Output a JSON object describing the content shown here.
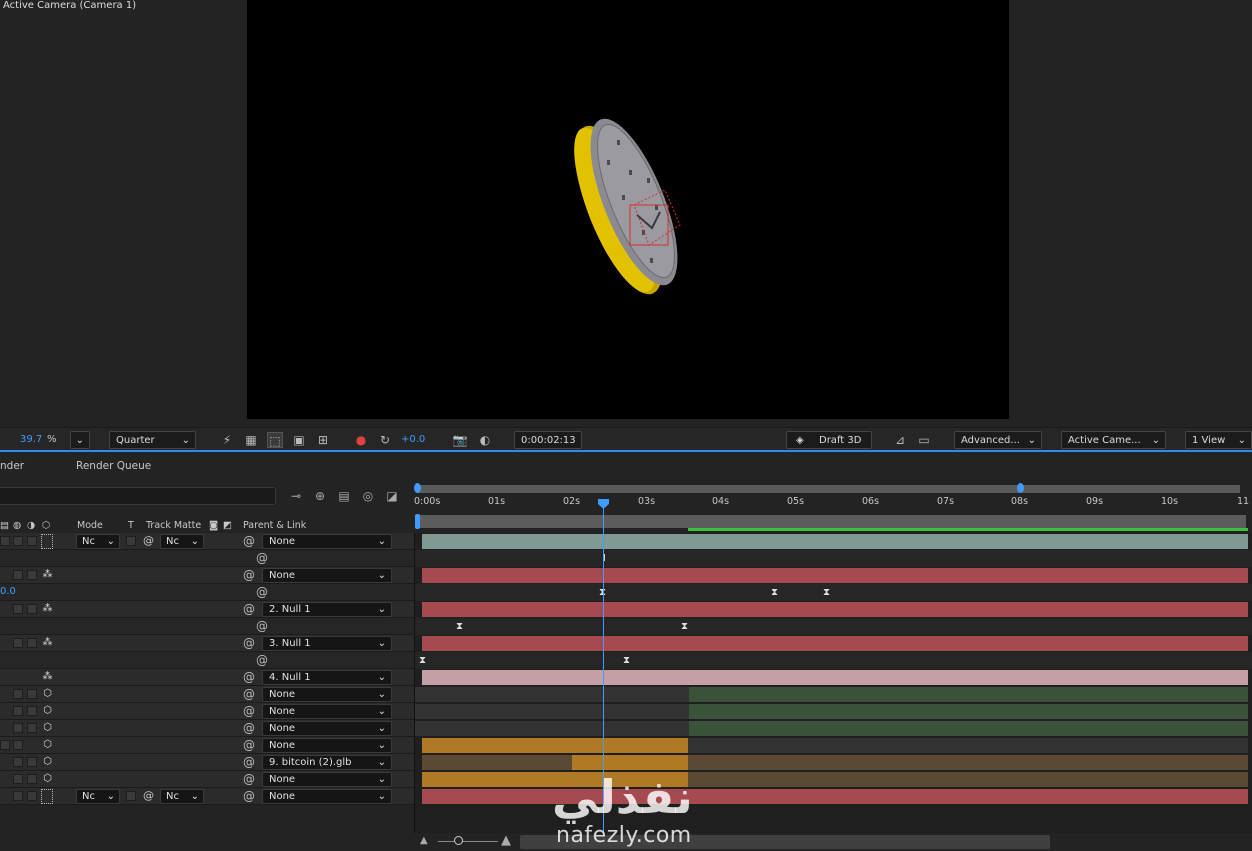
{
  "viewer": {
    "title": "Active Camera (Camera 1)"
  },
  "viewer_toolbar": {
    "zoom_value": "39.7",
    "zoom_unit": "%",
    "resolution": "Quarter",
    "exposure": "+0.0",
    "timecode": "0:00:02:13",
    "renderer": "Draft 3D",
    "renderer_mode": "Advanced...",
    "camera_view": "Active Came...",
    "view_layout": "1 View"
  },
  "timeline": {
    "tabs": [
      "nder",
      "Render Queue"
    ],
    "current_time_partial": "0.0",
    "columns": {
      "mode": "Mode",
      "t": "T",
      "track_matte": "Track Matte",
      "parent_link": "Parent & Link"
    },
    "ruler_labels": [
      "0:00s",
      "01s",
      "02s",
      "03s",
      "04s",
      "05s",
      "06s",
      "07s",
      "08s",
      "09s",
      "10s",
      "11"
    ],
    "layers": [
      {
        "type": "cam",
        "mode": "Nc",
        "matte": "Nc",
        "parent": "None",
        "bar": "#7f9a94"
      },
      {
        "type": "sub"
      },
      {
        "type": "null",
        "parent": "None",
        "bar": "#a54a4e"
      },
      {
        "type": "sub"
      },
      {
        "type": "null",
        "parent": "2. Null 1",
        "bar": "#a54a4e"
      },
      {
        "type": "sub"
      },
      {
        "type": "null",
        "parent": "3. Null 1",
        "bar": "#a54a4e"
      },
      {
        "type": "sub"
      },
      {
        "type": "null",
        "parent": "4. Null 1",
        "bar": "#c4a0a6"
      },
      {
        "type": "obj",
        "parent": "None",
        "bar": "#3a513a"
      },
      {
        "type": "obj",
        "parent": "None",
        "bar": "#3a513a"
      },
      {
        "type": "obj",
        "parent": "None",
        "bar": "#3a513a"
      },
      {
        "type": "obj",
        "parent": "None",
        "bar": "#b07a25"
      },
      {
        "type": "obj",
        "parent": "9. bitcoin (2).glb",
        "bar": "#b07a25"
      },
      {
        "type": "obj",
        "parent": "None",
        "bar": "#b07a25"
      },
      {
        "type": "cam",
        "mode": "Nc",
        "matte": "Nc",
        "parent": "None",
        "bar": "#a54a4e"
      }
    ]
  },
  "watermark": {
    "arabic": "نفذلي",
    "latin": "nafezly.com"
  },
  "colors": {
    "accent": "#3f9bff",
    "null_bar": "#a54a4e",
    "gold": "#d8b400"
  }
}
